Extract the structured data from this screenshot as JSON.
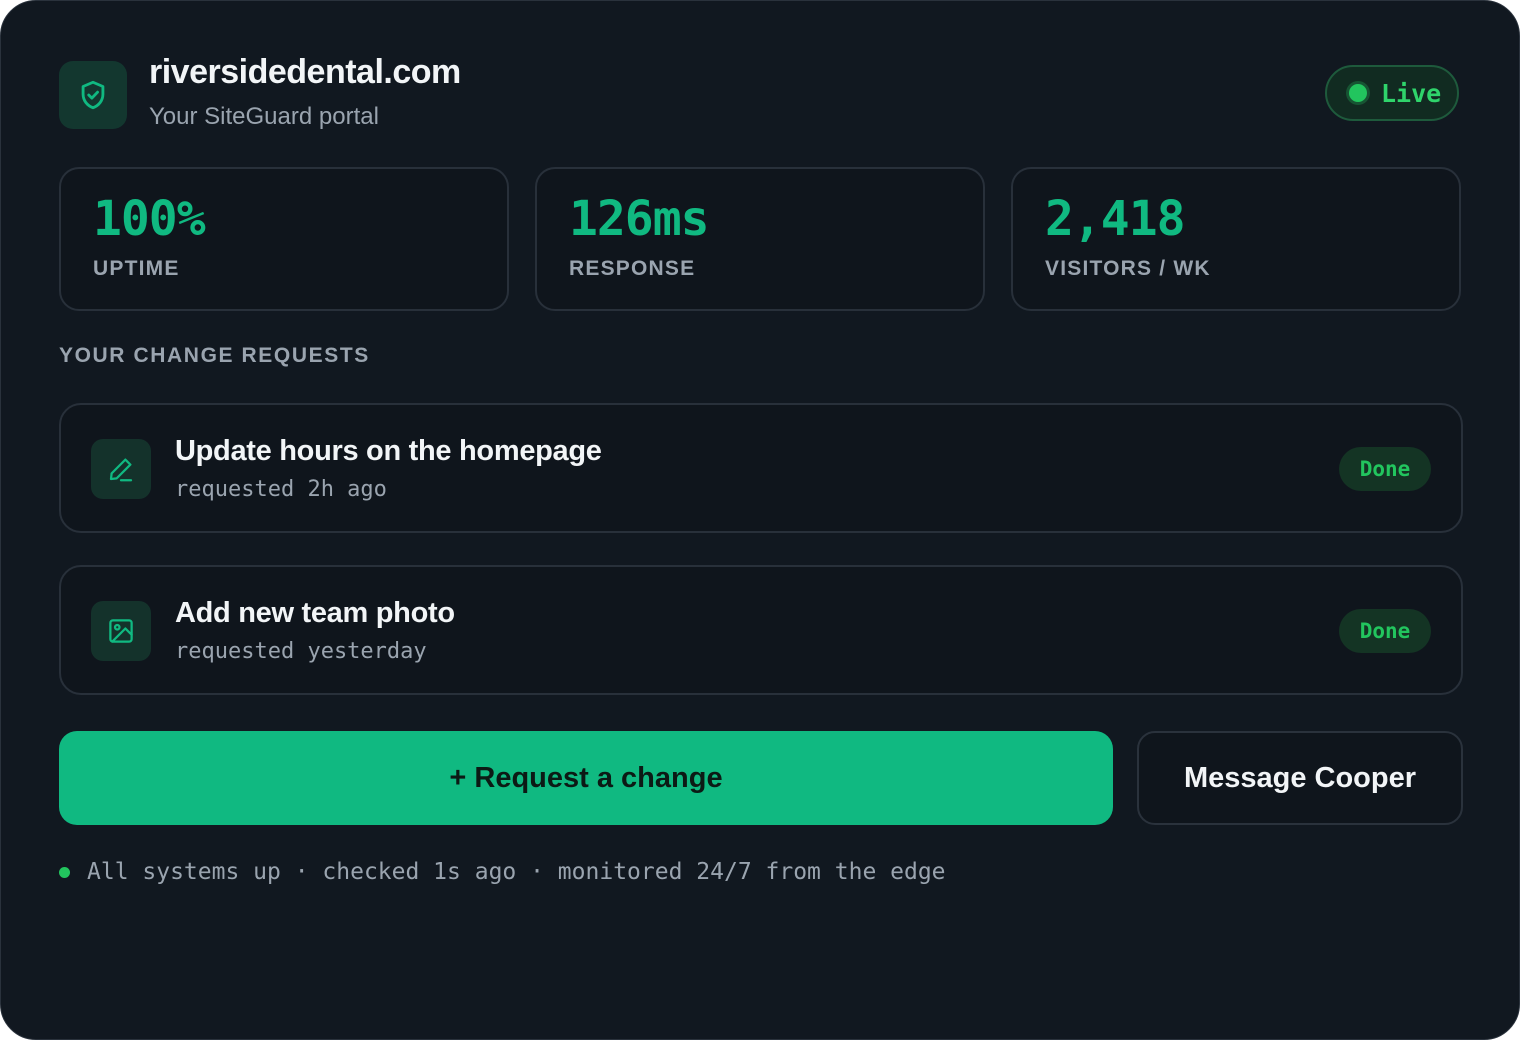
{
  "header": {
    "title": "riversidedental.com",
    "subtitle": "Your SiteGuard portal",
    "logo_icon": "shield-check-icon",
    "status_label": "Live",
    "status_color": "#22c55e"
  },
  "stats": [
    {
      "value": "100%",
      "label": "UPTIME"
    },
    {
      "value": "126ms",
      "label": "RESPONSE"
    },
    {
      "value": "2,418",
      "label": "VISITORS / WK"
    }
  ],
  "requests": {
    "section_title": "YOUR CHANGE REQUESTS",
    "items": [
      {
        "title": "Update hours on the homepage",
        "meta": "requested 2h ago",
        "status": "Done",
        "icon": "pencil-icon"
      },
      {
        "title": "Add new team photo",
        "meta": "requested yesterday",
        "status": "Done",
        "icon": "image-icon"
      }
    ]
  },
  "actions": {
    "primary_label": "+ Request a change",
    "secondary_label": "Message Cooper"
  },
  "footer": {
    "text": "All systems up · checked 1s ago · monitored 24/7 from the edge"
  },
  "colors": {
    "accent": "#10b981",
    "background": "#111820",
    "success": "#22c55e"
  }
}
